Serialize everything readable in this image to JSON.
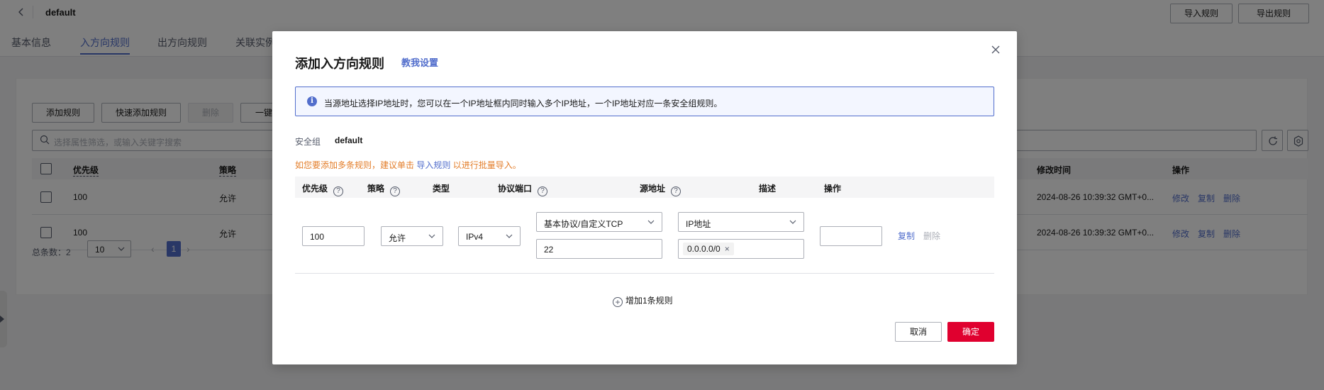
{
  "header": {
    "title": "default",
    "import_label": "导入规则",
    "export_label": "导出规则"
  },
  "tabs": [
    {
      "label": "基本信息"
    },
    {
      "label": "入方向规则"
    },
    {
      "label": "出方向规则"
    },
    {
      "label": "关联实例"
    }
  ],
  "toolbar": {
    "add_rule": "添加规则",
    "quick_add": "快速添加规则",
    "delete": "删除",
    "one_click": "一键"
  },
  "search": {
    "placeholder": "选择属性筛选，或输入关键字搜索"
  },
  "table": {
    "col_priority": "优先级",
    "col_policy": "策略",
    "col_modified": "修改时间",
    "col_action": "操作",
    "rows": [
      {
        "priority": "100",
        "policy": "允许",
        "modified": "2024-08-26 10:39:32 GMT+0...",
        "edit": "修改",
        "copy": "复制",
        "delete": "删除"
      },
      {
        "priority": "100",
        "policy": "允许",
        "modified": "2024-08-26 10:39:32 GMT+0...",
        "edit": "修改",
        "copy": "复制",
        "delete": "删除"
      }
    ]
  },
  "pager": {
    "total_label": "总条数：2",
    "page_size": "10",
    "current_page": "1"
  },
  "dialog": {
    "title": "添加入方向规则",
    "help_link": "教我设置",
    "info": "当源地址选择IP地址时，您可以在一个IP地址框内同时输入多个IP地址，一个IP地址对应一条安全组规则。",
    "sg_label": "安全组",
    "sg_value": "default",
    "warn_prefix": "如您要添加多条规则，建议单击",
    "warn_link": "导入规则",
    "warn_suffix": "以进行批量导入。",
    "headers": {
      "priority": "优先级",
      "policy": "策略",
      "type": "类型",
      "port": "协议端口",
      "source": "源地址",
      "desc": "描述",
      "action": "操作"
    },
    "row": {
      "priority": "100",
      "policy": "允许",
      "type": "IPv4",
      "protocol": "基本协议/自定义TCP",
      "port": "22",
      "source_type": "IP地址",
      "source_ip": "0.0.0.0/0",
      "desc": "",
      "copy": "复制",
      "delete": "删除"
    },
    "add_rule": "增加1条规则",
    "cancel": "取消",
    "ok": "确定"
  },
  "colors": {
    "accent": "#526ecc",
    "primary_button": "#e0002f",
    "warning": "#e37d29"
  }
}
